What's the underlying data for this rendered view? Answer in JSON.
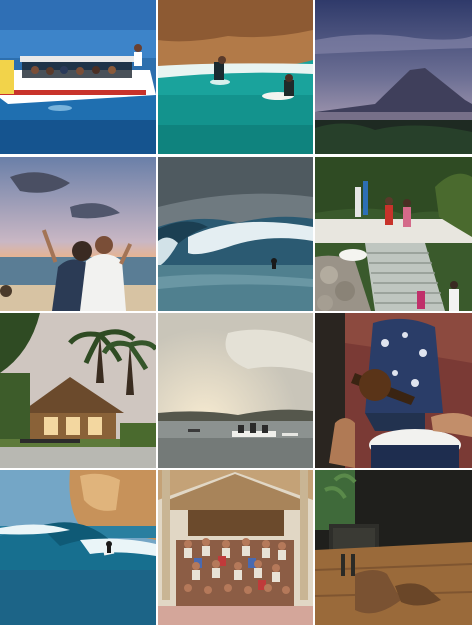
{
  "gallery": {
    "tiles": [
      {
        "subject": "boat-with-surfers",
        "palette": {
          "sky": "#3d84c9",
          "sea": "#1f6fb0",
          "hull": "#ffffff",
          "stripe": "#c8332b"
        }
      },
      {
        "subject": "surfers-in-turquoise-bay",
        "palette": {
          "cliff": "#b27a48",
          "sea": "#1aa39c",
          "foam": "#e8f4f2"
        }
      },
      {
        "subject": "volcano-at-dusk",
        "palette": {
          "sky": "#6c6f94",
          "mountain": "#3f3f5b",
          "haze": "#b0a2b8",
          "ground": "#1e2a22"
        }
      },
      {
        "subject": "couple-on-beach-sunset",
        "palette": {
          "sky": "#8a98b4",
          "sunset": "#f3b27a",
          "sea": "#5a7d95",
          "sand": "#d7c3a3"
        }
      },
      {
        "subject": "barrel-wave",
        "palette": {
          "sky": "#6f7a80",
          "wave": "#2b5a72",
          "foam": "#e4eef2",
          "sea": "#50808f"
        }
      },
      {
        "subject": "stairs-to-beach-with-surfboards",
        "palette": {
          "trees": "#3a5a2c",
          "stone": "#9a9388",
          "stairs": "#bfc6c0",
          "wall": "#e8e6df"
        }
      },
      {
        "subject": "bamboo-lodge-with-palms",
        "palette": {
          "sky": "#cfc6c0",
          "palms": "#2f4b23",
          "roof": "#6b4a2c",
          "lawn": "#5d7a3a"
        }
      },
      {
        "subject": "boats-on-calm-sea",
        "palette": {
          "sky": "#c9c5b9",
          "sun": "#f6ead0",
          "sea": "#8c9290",
          "land": "#55574c"
        }
      },
      {
        "subject": "musician-with-guitar-and-drum",
        "palette": {
          "bg": "#7a3a35",
          "shirt": "#2a3d68",
          "skin": "#b07a55",
          "drum": "#f2f2ef"
        }
      },
      {
        "subject": "surfer-near-cliff",
        "palette": {
          "sky": "#74a6c6",
          "cliff": "#c7925a",
          "wave": "#176f8f",
          "foam": "#eaf5f8"
        }
      },
      {
        "subject": "group-photo-bamboo-hall",
        "palette": {
          "roof": "#c4a277",
          "wall": "#e1d7c5",
          "crowd": "#8c5d45",
          "floor": "#d4a69a"
        }
      },
      {
        "subject": "boots-on-wooden-table",
        "palette": {
          "bg": "#1f1f1c",
          "table": "#9a6a3a",
          "boot": "#7a5232",
          "plant": "#3f6a3a"
        }
      }
    ]
  }
}
